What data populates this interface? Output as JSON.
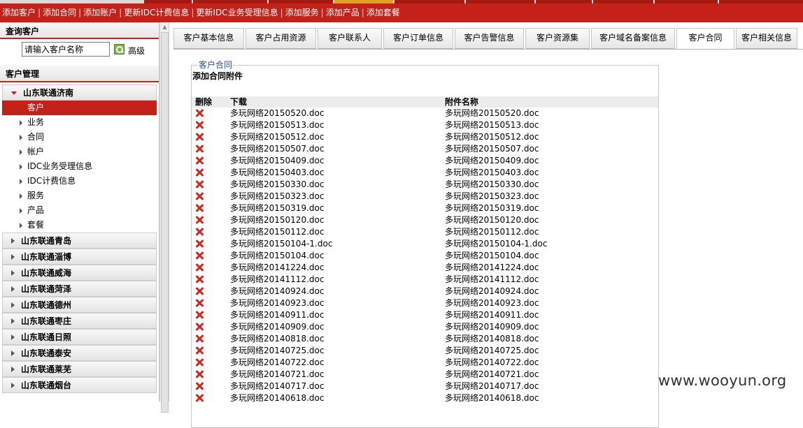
{
  "actions": [
    "添加客户",
    "添加合同",
    "添加账户",
    "更新IDC计费信息",
    "更新IDC业务受理信息",
    "添加服务",
    "添加产品",
    "添加套餐"
  ],
  "search": {
    "title": "查询客户",
    "value": "请输入客户名称",
    "advanced_label": "高级"
  },
  "customer_mgmt": {
    "title": "客户管理",
    "open_group": "山东联通济南",
    "active_item": "客户",
    "sub_items": [
      "业务",
      "合同",
      "帐户",
      "IDC业务受理信息",
      "IDC计费信息",
      "服务",
      "产品",
      "套餐"
    ],
    "groups": [
      "山东联通青岛",
      "山东联通淄博",
      "山东联通威海",
      "山东联通菏泽",
      "山东联通德州",
      "山东联通枣庄",
      "山东联通日照",
      "山东联通泰安",
      "山东联通莱芜",
      "山东联通烟台"
    ]
  },
  "tabs": [
    "客户基本信息",
    "客户占用资源",
    "客户联系人",
    "客户订单信息",
    "客户告警信息",
    "客户资源集",
    "客户域名备案信息",
    "客户合同",
    "客户相关信息"
  ],
  "active_tab": "客户合同",
  "contract": {
    "legend": "客户合同",
    "add_title": "添加合同附件",
    "columns": {
      "delete": "删除",
      "download": "下载",
      "name": "附件名称"
    },
    "files": [
      "多玩网络20150520.doc",
      "多玩网络20150513.doc",
      "多玩网络20150512.doc",
      "多玩网络20150507.doc",
      "多玩网络20150409.doc",
      "多玩网络20150403.doc",
      "多玩网络20150330.doc",
      "多玩网络20150323.doc",
      "多玩网络20150319.doc",
      "多玩网络20150120.doc",
      "多玩网络20150112.doc",
      "多玩网络20150104-1.doc",
      "多玩网络20150104.doc",
      "多玩网络20141224.doc",
      "多玩网络20141112.doc",
      "多玩网络20140924.doc",
      "多玩网络20140923.doc",
      "多玩网络20140911.doc",
      "多玩网络20140909.doc",
      "多玩网络20140818.doc",
      "多玩网络20140725.doc",
      "多玩网络20140722.doc",
      "多玩网络20140721.doc",
      "多玩网络20140717.doc",
      "多玩网络20140618.doc"
    ]
  },
  "watermark": "www.wooyun.org",
  "colors": {
    "brand_red": "#c42118",
    "legend_blue": "#2b4fa8",
    "delete_red": "#d4271c"
  }
}
